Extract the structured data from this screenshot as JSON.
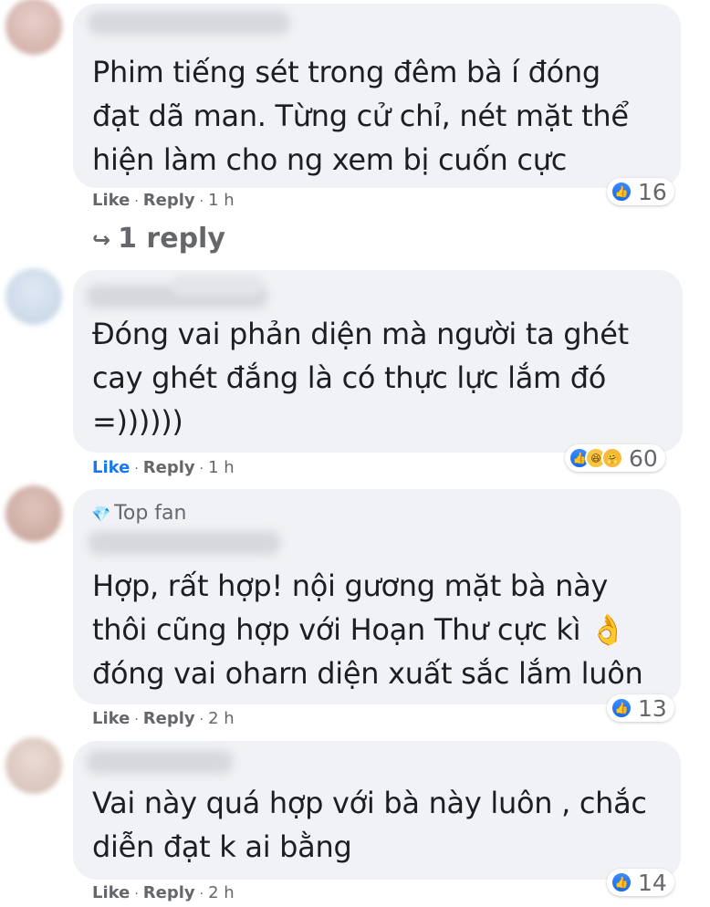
{
  "comments": [
    {
      "badge": "",
      "lines": [
        "Phim tiếng sét trong đêm bà í đóng",
        "đạt dã man. Từng cử chỉ, nét mặt thể",
        "hiện làm cho ng xem bị cuốn cực"
      ],
      "reactions": [
        "like"
      ],
      "reaction_count": "16",
      "like_label": "Like",
      "reply_label": "Reply",
      "time": "1 h",
      "liked": false
    },
    {
      "badge": "",
      "lines": [
        "Đóng vai phản diện mà người ta ghét",
        "cay ghét đắng là có thực lực lắm đó",
        "=))))))"
      ],
      "reactions": [
        "like",
        "haha",
        "care"
      ],
      "reaction_count": "60",
      "like_label": "Like",
      "reply_label": "Reply",
      "time": "1 h",
      "liked": true
    },
    {
      "badge": "Top fan",
      "lines": [
        "Hợp, rất hợp! nội gương mặt bà này",
        "thôi cũng hợp với Hoạn Thư cực kì 👌",
        "đóng vai oharn diện xuất sắc lắm luôn"
      ],
      "reactions": [
        "like"
      ],
      "reaction_count": "13",
      "like_label": "Like",
      "reply_label": "Reply",
      "time": "2 h",
      "liked": false
    },
    {
      "badge": "",
      "lines": [
        "Vai này quá hợp với bà này luôn , chắc",
        "diễn đạt k ai bằng"
      ],
      "reactions": [
        "like"
      ],
      "reaction_count": "14",
      "like_label": "Like",
      "reply_label": "Reply",
      "time": "2 h",
      "liked": false
    }
  ],
  "replies_link": "1 reply",
  "separator": "·",
  "colors": {
    "bubble": "#f0f2f5",
    "text": "#1c1e21",
    "meta": "#65676b",
    "like_blue": "#1877f2"
  }
}
